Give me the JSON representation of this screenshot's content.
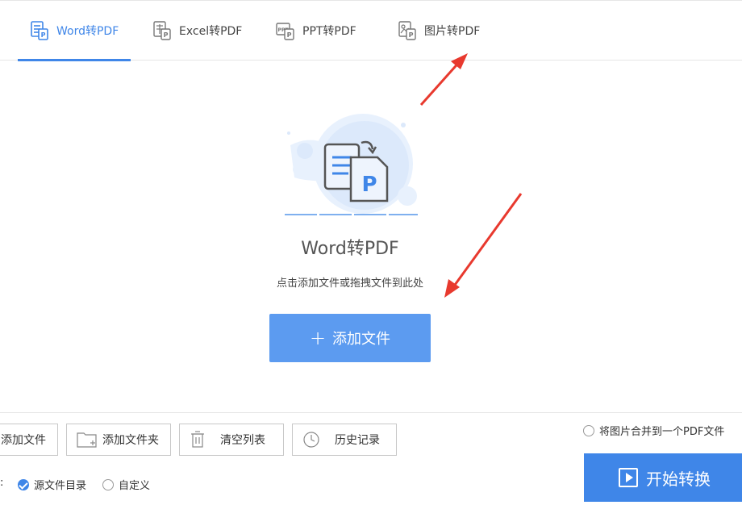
{
  "tabs": [
    {
      "label": "Word转PDF",
      "icon": "word-doc-icon"
    },
    {
      "label": "Excel转PDF",
      "icon": "excel-doc-icon"
    },
    {
      "label": "PPT转PDF",
      "icon": "ppt-doc-icon"
    },
    {
      "label": "图片转PDF",
      "icon": "image-doc-icon"
    }
  ],
  "main": {
    "illustration_icon": "word-to-pdf-illustration",
    "title": "Word转PDF",
    "hint": "点击添加文件或拖拽文件到此处",
    "add_button": {
      "plus": "+",
      "label": "添加文件"
    }
  },
  "toolbar": {
    "add_file": "添加文件",
    "add_folder": "添加文件夹",
    "clear_list": "清空列表",
    "history": "历史记录"
  },
  "merge_option": {
    "label": "将图片合并到一个PDF文件",
    "checked": false
  },
  "output": {
    "prefix": ":",
    "source_dir": {
      "label": "源文件目录",
      "checked": true
    },
    "custom": {
      "label": "自定义",
      "checked": false
    }
  },
  "start_button": {
    "label": "开始转换"
  },
  "colors": {
    "accent": "#3f86e8",
    "button_light": "#5c9bf0",
    "annotation_arrow": "#e8392e"
  }
}
